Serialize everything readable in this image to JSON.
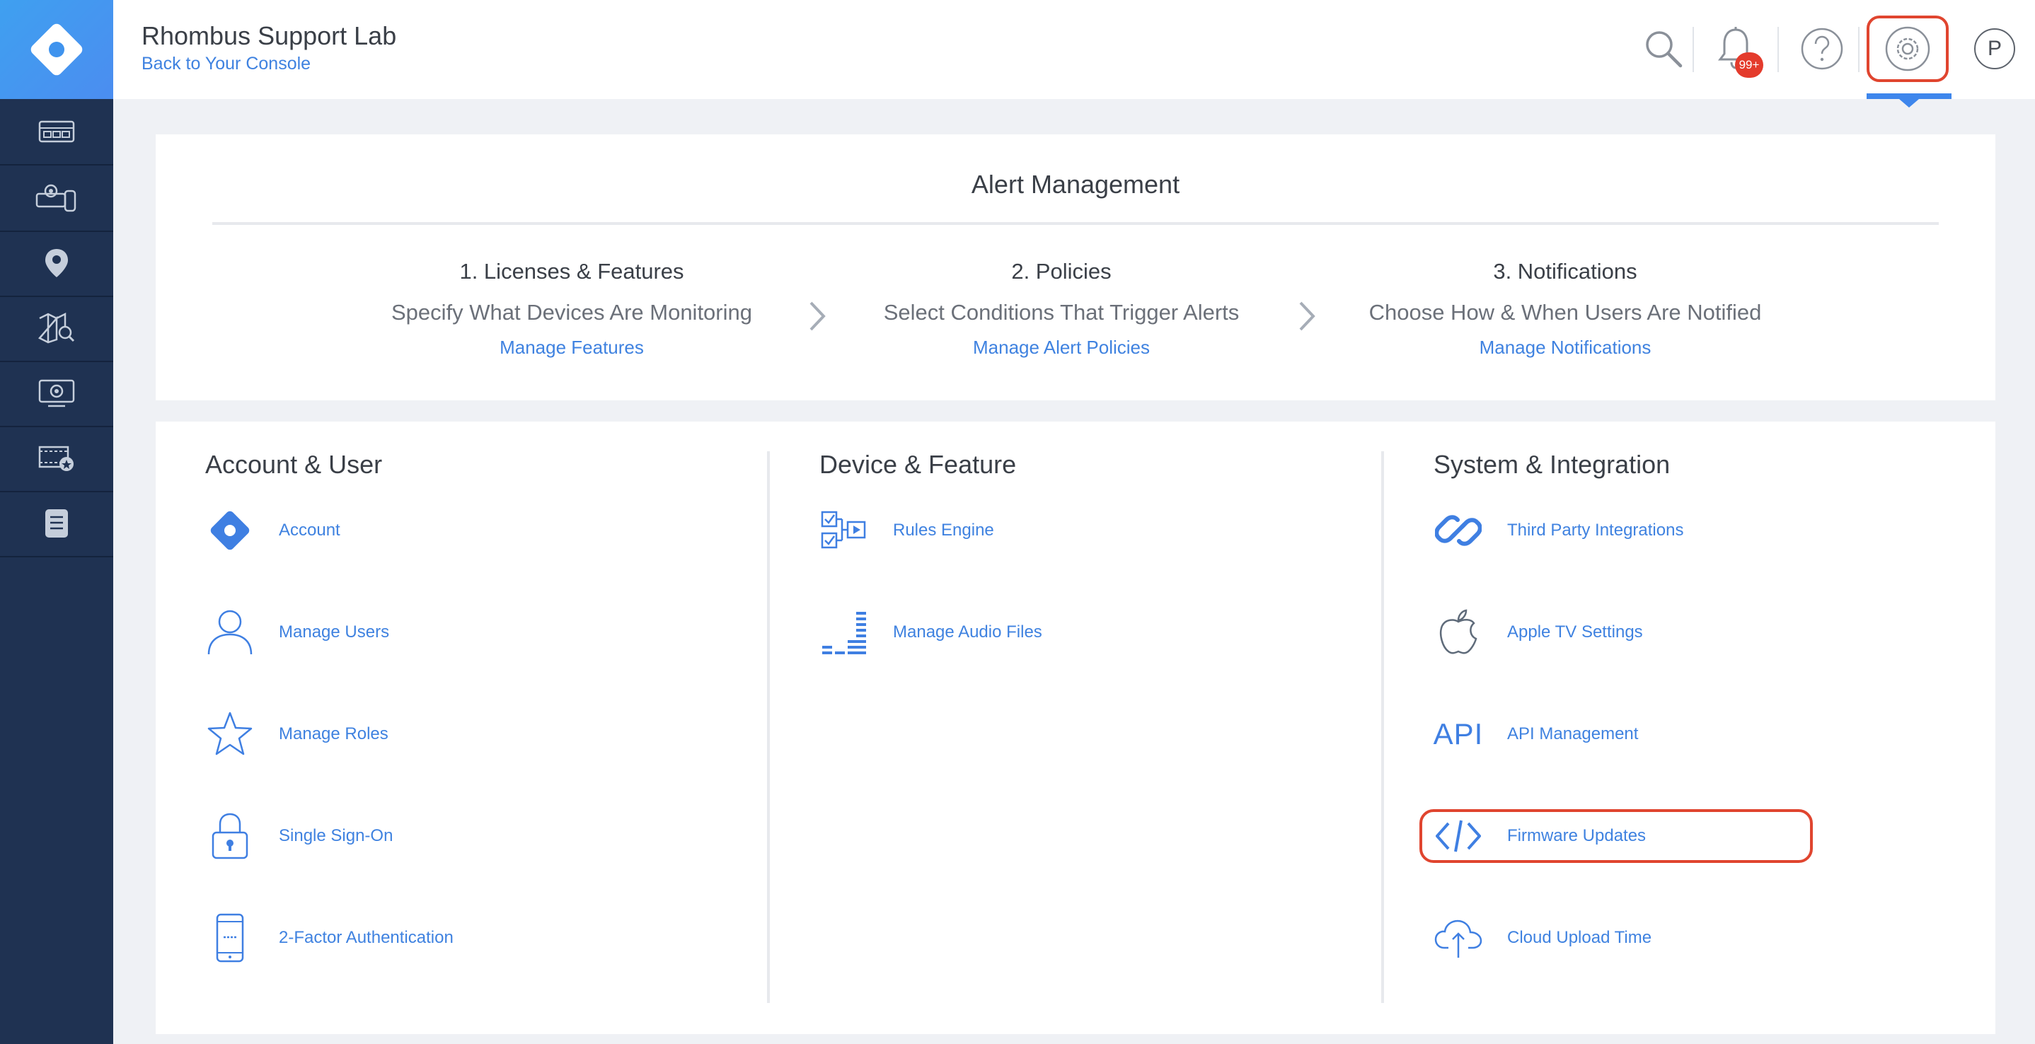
{
  "header": {
    "org_name": "Rhombus Support Lab",
    "back_link": "Back to Your Console",
    "notification_badge": "99+",
    "avatar_initial": "P",
    "icons": [
      "search-icon",
      "bell-icon",
      "help-icon",
      "settings-icon"
    ]
  },
  "sidebar": {
    "items": [
      "dashboard-icon",
      "devices-icon",
      "location-pin-icon",
      "map-search-icon",
      "video-wall-icon",
      "saved-video-icon",
      "report-icon"
    ]
  },
  "alert_management": {
    "title": "Alert Management",
    "steps": [
      {
        "title": "1. Licenses & Features",
        "desc": "Specify What Devices Are Monitoring",
        "link": "Manage Features"
      },
      {
        "title": "2. Policies",
        "desc": "Select Conditions That Trigger Alerts",
        "link": "Manage Alert Policies"
      },
      {
        "title": "3. Notifications",
        "desc": "Choose How & When Users Are Notified",
        "link": "Manage Notifications"
      }
    ]
  },
  "settings": {
    "columns": [
      {
        "title": "Account & User",
        "items": [
          {
            "label": "Account",
            "icon": "rhombus-logo-icon"
          },
          {
            "label": "Manage Users",
            "icon": "user-icon"
          },
          {
            "label": "Manage Roles",
            "icon": "star-icon"
          },
          {
            "label": "Single Sign-On",
            "icon": "lock-icon"
          },
          {
            "label": "2-Factor Authentication",
            "icon": "phone-icon"
          }
        ]
      },
      {
        "title": "Device & Feature",
        "items": [
          {
            "label": "Rules Engine",
            "icon": "rules-icon"
          },
          {
            "label": "Manage Audio Files",
            "icon": "audio-levels-icon"
          }
        ]
      },
      {
        "title": "System & Integration",
        "items": [
          {
            "label": "Third Party Integrations",
            "icon": "link-icon"
          },
          {
            "label": "Apple TV Settings",
            "icon": "apple-icon"
          },
          {
            "label": "API Management",
            "icon": "api-icon",
            "icon_text": "API"
          },
          {
            "label": "Firmware Updates",
            "icon": "code-icon"
          },
          {
            "label": "Cloud Upload Time",
            "icon": "cloud-upload-icon"
          }
        ]
      }
    ]
  },
  "colors": {
    "sidebar": "#1f3252",
    "accent": "#3f82e0",
    "highlight": "#e0452f",
    "badge": "#e43b2c"
  }
}
